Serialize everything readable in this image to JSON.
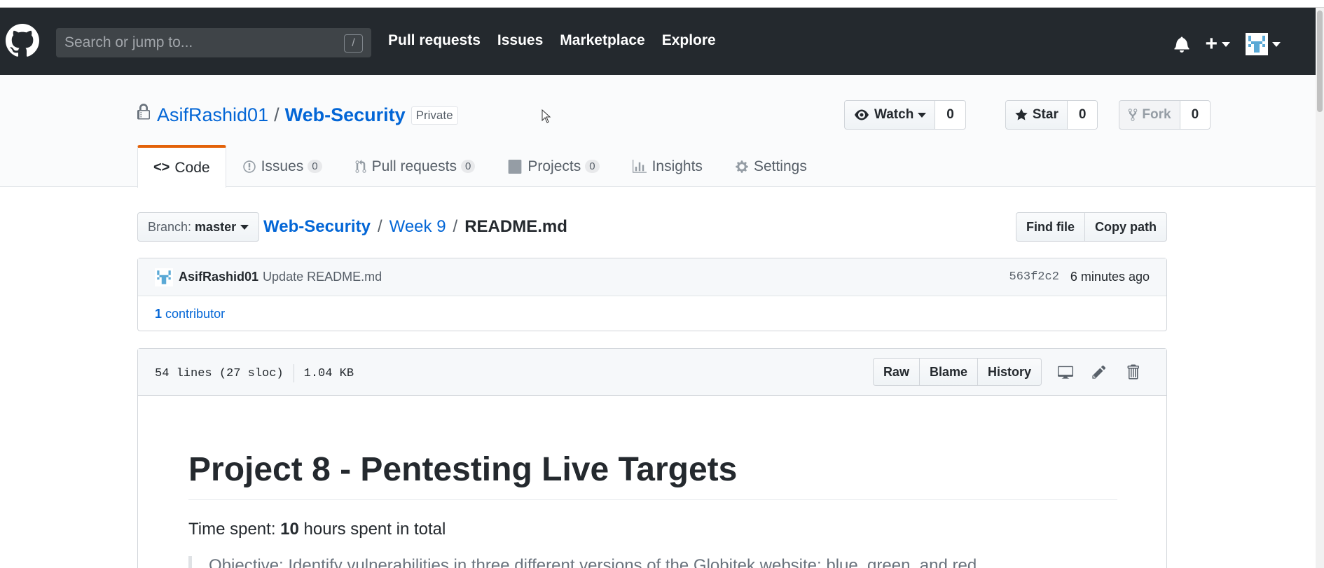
{
  "header": {
    "search_placeholder": "Search or jump to...",
    "search_shortcut": "/",
    "nav": [
      "Pull requests",
      "Issues",
      "Marketplace",
      "Explore"
    ],
    "right_icons": [
      "bell-icon",
      "plus-icon",
      "avatar"
    ]
  },
  "repo": {
    "owner": "AsifRashid01",
    "separator": "/",
    "name": "Web-Security",
    "visibility": "Private",
    "watch_label": "Watch",
    "watch_count": "0",
    "star_label": "Star",
    "star_count": "0",
    "fork_label": "Fork",
    "fork_count": "0"
  },
  "tabs": [
    {
      "label": "Code",
      "icon": "code-icon",
      "selected": true
    },
    {
      "label": "Issues",
      "icon": "issue-icon",
      "count": "0"
    },
    {
      "label": "Pull requests",
      "icon": "pull-request-icon",
      "count": "0"
    },
    {
      "label": "Projects",
      "icon": "project-icon",
      "count": "0"
    },
    {
      "label": "Insights",
      "icon": "graph-icon"
    },
    {
      "label": "Settings",
      "icon": "gear-icon"
    }
  ],
  "file_nav": {
    "branch_label": "Branch:",
    "branch_name": "master",
    "breadcrumb": [
      "Web-Security",
      "Week 9",
      "README.md"
    ],
    "find_file": "Find file",
    "copy_path": "Copy path"
  },
  "commit": {
    "author": "AsifRashid01",
    "message": "Update README.md",
    "sha": "563f2c2",
    "time": "6 minutes ago",
    "contributors_count": "1",
    "contributors_label": "contributor"
  },
  "file": {
    "lines": "54 lines (27 sloc)",
    "size": "1.04 KB",
    "raw": "Raw",
    "blame": "Blame",
    "history": "History"
  },
  "readme": {
    "title": "Project 8 - Pentesting Live Targets",
    "time_spent_prefix": "Time spent: ",
    "time_spent_value": "10",
    "time_spent_suffix": " hours spent in total",
    "quote_partial": "Objective: Identify vulnerabilities in three different versions of the Globitek website: blue, green, and red."
  },
  "colors": {
    "header_bg": "#24292e",
    "link": "#0366d6",
    "selected_tab_accent": "#e36209"
  }
}
